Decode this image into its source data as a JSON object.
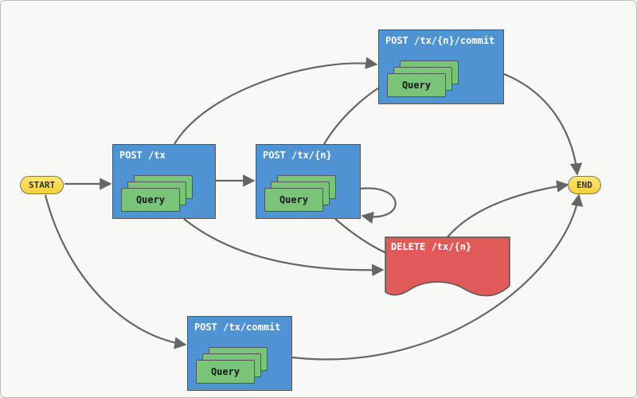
{
  "control": {
    "start": "START",
    "end": "END"
  },
  "query_label": "Query",
  "nodes": {
    "tx": {
      "title": "POST /tx"
    },
    "txn": {
      "title": "POST /tx/{n}"
    },
    "commit_n": {
      "title": "POST /tx/{n}/commit"
    },
    "commit": {
      "title": "POST /tx/commit"
    },
    "delete": {
      "title": "DELETE /tx/{n}"
    }
  },
  "edges": [
    {
      "from": "start",
      "to": "tx"
    },
    {
      "from": "start",
      "to": "commit"
    },
    {
      "from": "tx",
      "to": "txn"
    },
    {
      "from": "tx",
      "to": "commit_n"
    },
    {
      "from": "tx",
      "to": "delete"
    },
    {
      "from": "txn",
      "to": "txn"
    },
    {
      "from": "txn",
      "to": "commit_n"
    },
    {
      "from": "txn",
      "to": "delete"
    },
    {
      "from": "commit_n",
      "to": "end"
    },
    {
      "from": "delete",
      "to": "end"
    },
    {
      "from": "commit",
      "to": "end"
    }
  ]
}
